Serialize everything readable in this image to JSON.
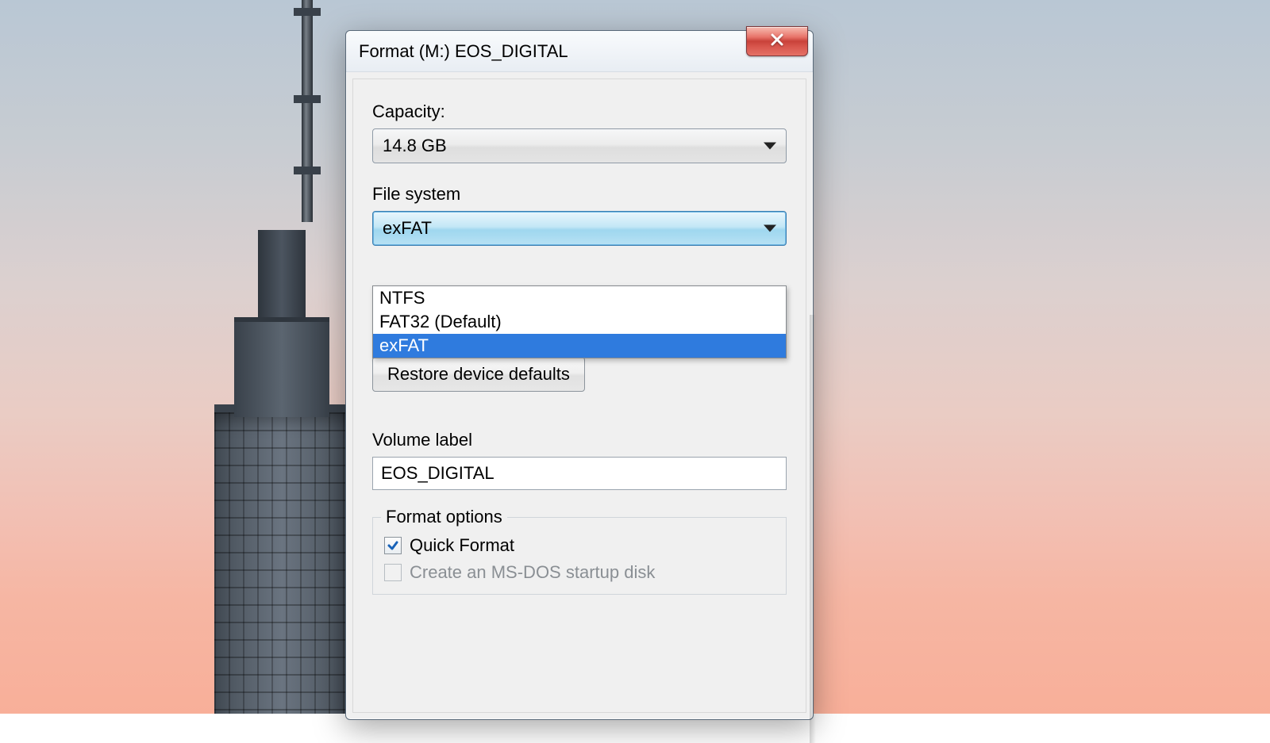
{
  "dialog": {
    "title": "Format (M:) EOS_DIGITAL"
  },
  "capacity": {
    "label": "Capacity:",
    "value": "14.8 GB"
  },
  "filesystem": {
    "label": "File system",
    "value": "exFAT",
    "options": [
      "NTFS",
      "FAT32 (Default)",
      "exFAT"
    ],
    "highlighted_index": 2
  },
  "restore_button": "Restore device defaults",
  "volume": {
    "label": "Volume label",
    "value": "EOS_DIGITAL"
  },
  "format_options": {
    "legend": "Format options",
    "quick_format": {
      "label": "Quick Format",
      "checked": true
    },
    "msdos": {
      "label": "Create an MS-DOS startup disk",
      "checked": false,
      "enabled": false
    }
  }
}
